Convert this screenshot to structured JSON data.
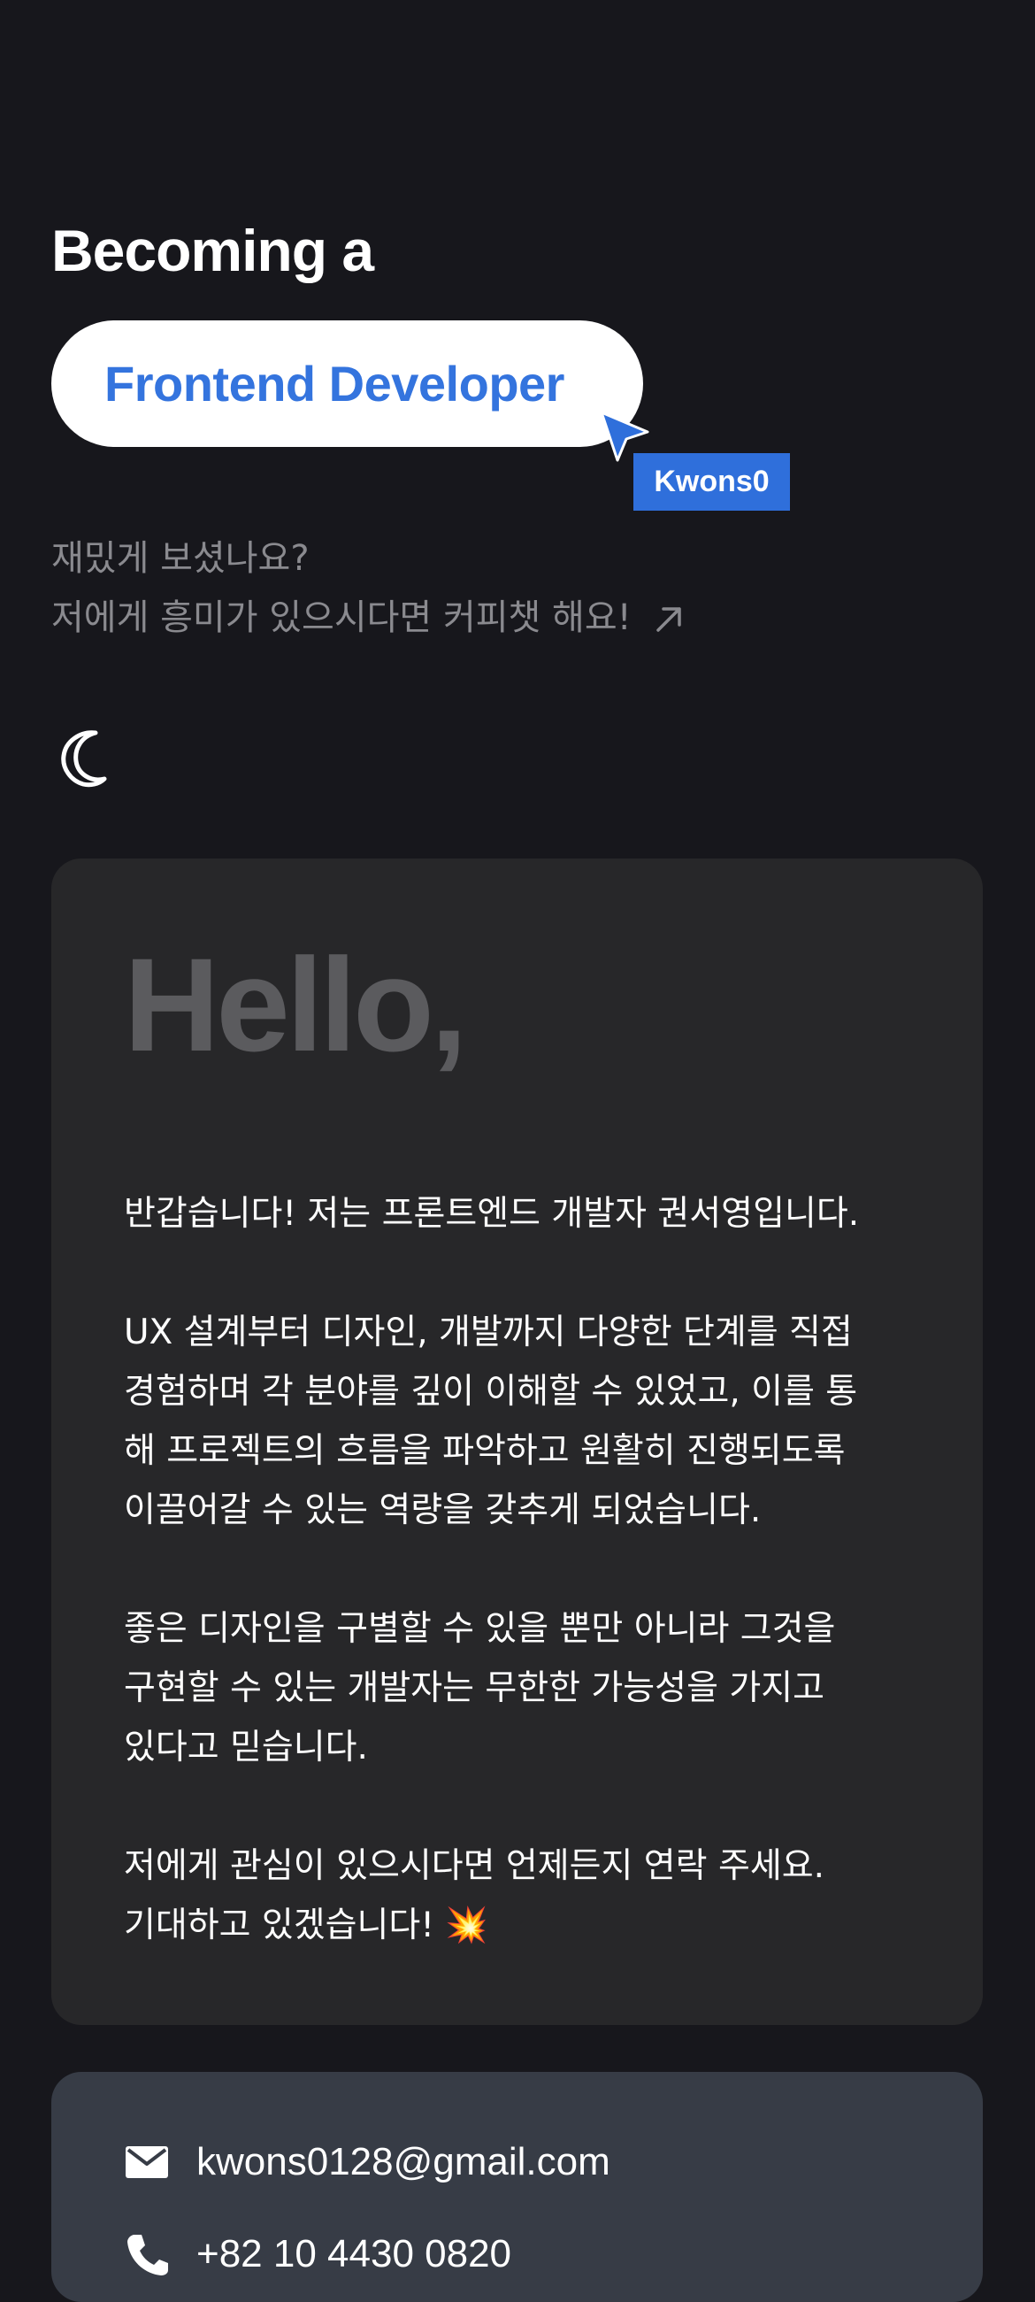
{
  "hero": {
    "title": "Becoming a",
    "role": "Frontend Developer",
    "cursor_tag": "Kwons0"
  },
  "intro": {
    "line1": "재밌게 보셨나요?",
    "line2": "저에게 흥미가 있으시다면 커피챗 해요!",
    "arrow_icon": "arrow-up-right-icon"
  },
  "theme_toggle": {
    "icon": "moon-icon"
  },
  "about": {
    "heading": "Hello,",
    "p1": "반갑습니다! 저는 프론트엔드 개발자 권서영입니다.",
    "p2_lines": [
      "UX 설계부터 디자인, 개발까지 다양한 단계를 직접",
      "경험하며 각 분야를 깊이 이해할 수 있었고, 이를 통",
      "해 프로젝트의 흐름을 파악하고 원활히 진행되도록",
      "이끌어갈 수 있는 역량을 갖추게 되었습니다."
    ],
    "p3_lines": [
      "좋은 디자인을 구별할 수 있을 뿐만 아니라 그것을",
      "구현할 수 있는 개발자는 무한한 가능성을 가지고",
      "있다고 믿습니다."
    ],
    "p4_lines": [
      "저에게 관심이 있으시다면 언제든지 연락 주세요.",
      "기대하고 있겠습니다! 💥"
    ]
  },
  "contact": {
    "email": "kwons0128@gmail.com",
    "phone": "+82 10 4430 0820",
    "email_icon": "mail-icon",
    "phone_icon": "phone-icon"
  },
  "colors": {
    "background": "#17171c",
    "accent": "#3474de",
    "card": "#272729",
    "contact_card": "#373c46"
  }
}
